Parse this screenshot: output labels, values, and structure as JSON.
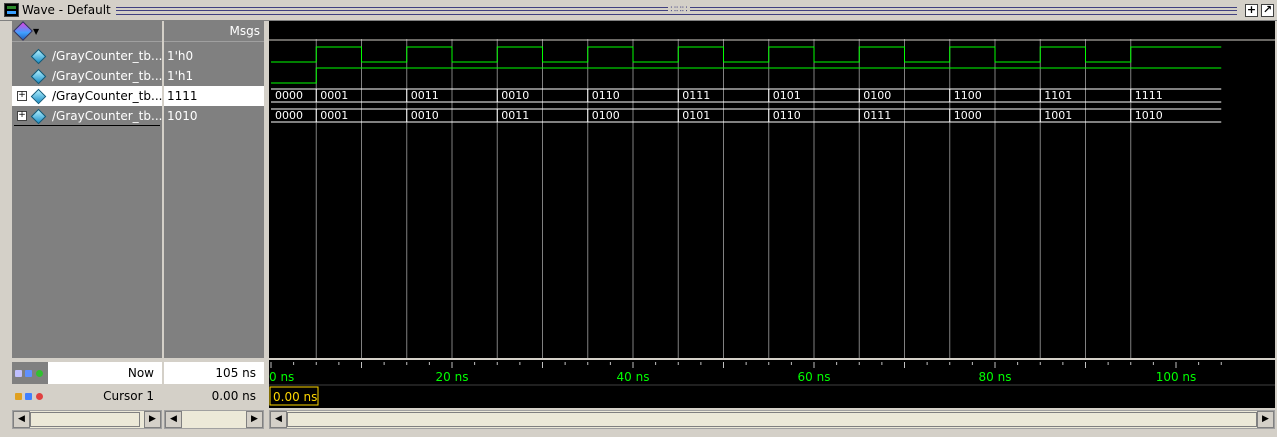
{
  "window": {
    "title": "Wave - Default",
    "grip": "∷∷∷",
    "btn_dock": "+",
    "btn_undock": "↗"
  },
  "header": {
    "msgs_label": "Msgs"
  },
  "signals": [
    {
      "name": "/GrayCounter_tb...",
      "value": "1'h0",
      "expandable": false
    },
    {
      "name": "/GrayCounter_tb...",
      "value": "1'h1",
      "expandable": false
    },
    {
      "name": "/GrayCounter_tb...",
      "value": "1111",
      "expandable": true,
      "selected": true
    },
    {
      "name": "/GrayCounter_tb...",
      "value": "1010",
      "expandable": true
    }
  ],
  "bus_gray": [
    "0000",
    "0001",
    "0011",
    "0010",
    "0110",
    "0111",
    "0101",
    "0100",
    "1100",
    "1101",
    "1111"
  ],
  "bus_bin": [
    "0000",
    "0001",
    "0010",
    "0011",
    "0100",
    "0101",
    "0110",
    "0111",
    "1000",
    "1001",
    "1010"
  ],
  "timeline": {
    "now_label": "Now",
    "now_value": "105 ns",
    "cursor_label": "Cursor 1",
    "cursor_value": "0.00 ns",
    "cursor_flag": "0.00 ns",
    "start_label": "0 ns",
    "tick_labels": [
      "20 ns",
      "40 ns",
      "60 ns",
      "80 ns",
      "100 ns"
    ],
    "unit_ns_total": 105
  },
  "colors": {
    "wave_green": "#00ff00",
    "grid": "#808080",
    "bus_white": "#ffffff",
    "cursor_flag": "#ffd700"
  }
}
